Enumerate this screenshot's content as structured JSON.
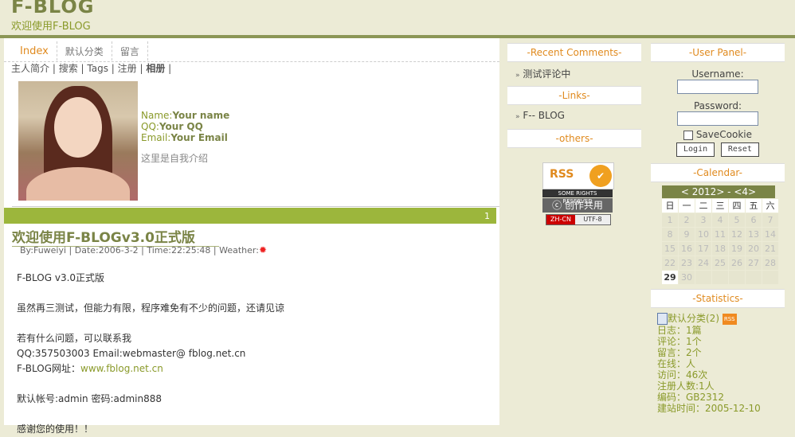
{
  "header": {
    "logo": "F-BLOG",
    "subtitle": "欢迎使用F-BLOG"
  },
  "nav": {
    "tabs": [
      "Index",
      "默认分类",
      "留言"
    ],
    "sublinks": [
      "主人简介",
      "搜索",
      "Tags",
      "注册",
      "相册"
    ]
  },
  "profile": {
    "name_label": "Name:",
    "name_value": "Your name",
    "qq_label": "QQ:",
    "qq_value": "Your QQ",
    "email_label": "Email:",
    "email_value": "Your Email",
    "intro": "这里是自我介绍"
  },
  "pager": {
    "page": "1"
  },
  "post": {
    "title": "欢迎使用F-BLOGv3.0正式版",
    "meta": "By:Fuweiyi | Date:2006-3-2 | Time:22:25:48 | Weather:",
    "lines": [
      "F-BLOG v3.0正式版",
      "",
      "虽然再三测试，但能力有限，程序难免有不少的问题，还请见谅",
      "",
      "若有什么问题，可以联系我",
      "QQ:357503003   Email:webmaster@ fblog.net.cn"
    ],
    "url_label": "F-BLOG网址：",
    "url": "www.fblog.net.cn",
    "account": "默认帐号:admin   密码:admin888",
    "thanks": "感谢您的使用！！"
  },
  "sidebar_mid": {
    "recent_title": "-Recent Comments-",
    "recent_item": "测试评论中",
    "links_title": "-Links-",
    "links_item": "F-- BLOG",
    "others_title": "-others-",
    "rss_text": "RSS",
    "rss_valid": "VALID",
    "srr": "SOME RIGHTS RESERVED",
    "cc": "创作共用",
    "enc_a": "ZH-CN",
    "enc_b": "UTF-8"
  },
  "sidebar_right": {
    "panel_title": "-User Panel-",
    "username_label": "Username:",
    "password_label": "Password:",
    "savecookie": "SaveCookie",
    "login_btn": "Login",
    "reset_btn": "Reset",
    "calendar_title": "-Calendar-",
    "calendar_head": "< 2012> - <4>",
    "weekdays": [
      "日",
      "一",
      "二",
      "三",
      "四",
      "五",
      "六"
    ],
    "days": [
      "1",
      "2",
      "3",
      "4",
      "5",
      "6",
      "7",
      "8",
      "9",
      "10",
      "11",
      "12",
      "13",
      "14",
      "15",
      "16",
      "17",
      "18",
      "19",
      "20",
      "21",
      "22",
      "23",
      "24",
      "25",
      "26",
      "27",
      "28",
      "29",
      "30"
    ],
    "today": "29",
    "stats_title": "-Statistics-",
    "category": "默认分类(2)",
    "rss_badge": "RSS",
    "stats": [
      "日志：1篇",
      "评论：1个",
      "留言：2个",
      "在线：人",
      "访问：46次",
      "注册人数:1人",
      "编码：GB2312",
      "建站时间：2005-12-10"
    ]
  }
}
